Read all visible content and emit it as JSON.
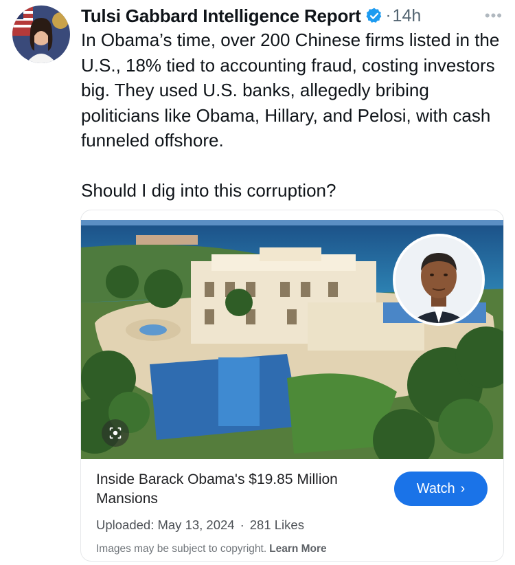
{
  "tweet": {
    "author_name": "Tulsi Gabbard Intelligence Report",
    "separator": "·",
    "time": "14h",
    "more": "•••",
    "body_paragraph_1": "In Obama’s time, over 200 Chinese firms listed in the U.S., 18% tied to accounting fraud, costing investors big. They used U.S. banks, allegedly bribing politicians like Obama, Hillary, and Pelosi, with cash funneled offshore.",
    "body_paragraph_2": "Should I dig into this corruption?"
  },
  "card": {
    "title": "Inside Barack Obama's $19.85 Million Mansions",
    "watch_label": "Watch",
    "uploaded": "Uploaded: May 13, 2024",
    "meta_separator": "·",
    "likes": "281 Likes",
    "copyright": "Images may be subject to copyright.",
    "learn_more": "Learn More"
  },
  "colors": {
    "verified_badge": "#1d9bf0",
    "watch_button": "#1a73e8",
    "ocean": "#1d5c93"
  },
  "icons": [
    "verified-badge-icon",
    "more-options-icon",
    "lens-icon",
    "chevron-right-icon"
  ]
}
